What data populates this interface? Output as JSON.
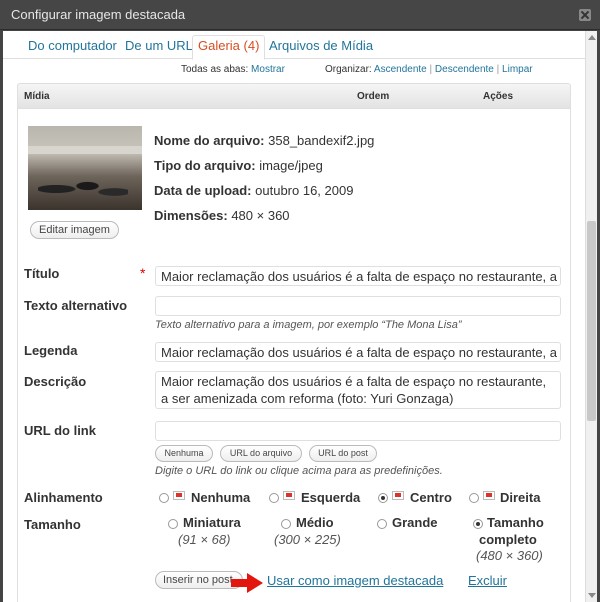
{
  "window": {
    "title": "Configurar imagem destacada"
  },
  "tabs": [
    {
      "label": "Do computador"
    },
    {
      "label": "De um URL"
    },
    {
      "label": "Galeria (4)"
    },
    {
      "label": "Arquivos de Mídia"
    }
  ],
  "filters": {
    "all_tabs_label": "Todas as abas:",
    "show": "Mostrar",
    "organize_label": "Organizar:",
    "ascending": "Ascendente",
    "descending": "Descendente",
    "clear": "Limpar",
    "separator": "|"
  },
  "table_header": {
    "media": "Mídia",
    "order": "Ordem",
    "actions": "Ações"
  },
  "file": {
    "name_label": "Nome do arquivo:",
    "name": "358_bandexif2.jpg",
    "type_label": "Tipo do arquivo:",
    "type": "image/jpeg",
    "upload_label": "Data de upload:",
    "upload": "outubro 16, 2009",
    "dims_label": "Dimensões:",
    "dims": "480 × 360",
    "edit_button": "Editar imagem"
  },
  "form": {
    "title_label": "Título",
    "required_mark": "*",
    "title_value": "Maior reclamação dos usuários é a falta de espaço no restaurante, a ser amenizada com reforma (foto: Yuri Gonzaga)",
    "alt_label": "Texto alternativo",
    "alt_value": "",
    "alt_help": "Texto alternativo para a imagem, por exemplo “The Mona Lisa”",
    "caption_label": "Legenda",
    "caption_value": "Maior reclamação dos usuários é a falta de espaço no restaurante, a ser amenizada com reforma (foto: Yuri Gonzaga)",
    "desc_label": "Descrição",
    "desc_value": "Maior reclamação dos usuários é a falta de espaço no restaurante, a ser amenizada com reforma (foto: Yuri Gonzaga)",
    "url_label": "URL do link",
    "url_value": "",
    "url_none": "Nenhuma",
    "url_file": "URL do arquivo",
    "url_post": "URL do post",
    "url_help": "Digite o URL do link ou clique acima para as predefinições.",
    "align_label": "Alinhamento",
    "align_options": [
      "Nenhuma",
      "Esquerda",
      "Centro",
      "Direita"
    ],
    "align_selected": "Centro",
    "size_label": "Tamanho",
    "size_thumbnail": "Miniatura",
    "size_thumbnail_dims": "(91 × 68)",
    "size_medium": "Médio",
    "size_medium_dims": "(300 × 225)",
    "size_large": "Grande",
    "size_full_1": "Tamanho",
    "size_full_2": "completo",
    "size_full_dims": "(480 × 360)",
    "size_selected": "Tamanho completo",
    "insert_button": "Inserir no post",
    "featured_link": "Usar como imagem destacada",
    "delete_link": "Excluir"
  },
  "colors": {
    "link": "#21759b",
    "active_tab": "#d54e21",
    "arrow": "#e3150f",
    "titlebar": "#464646"
  }
}
